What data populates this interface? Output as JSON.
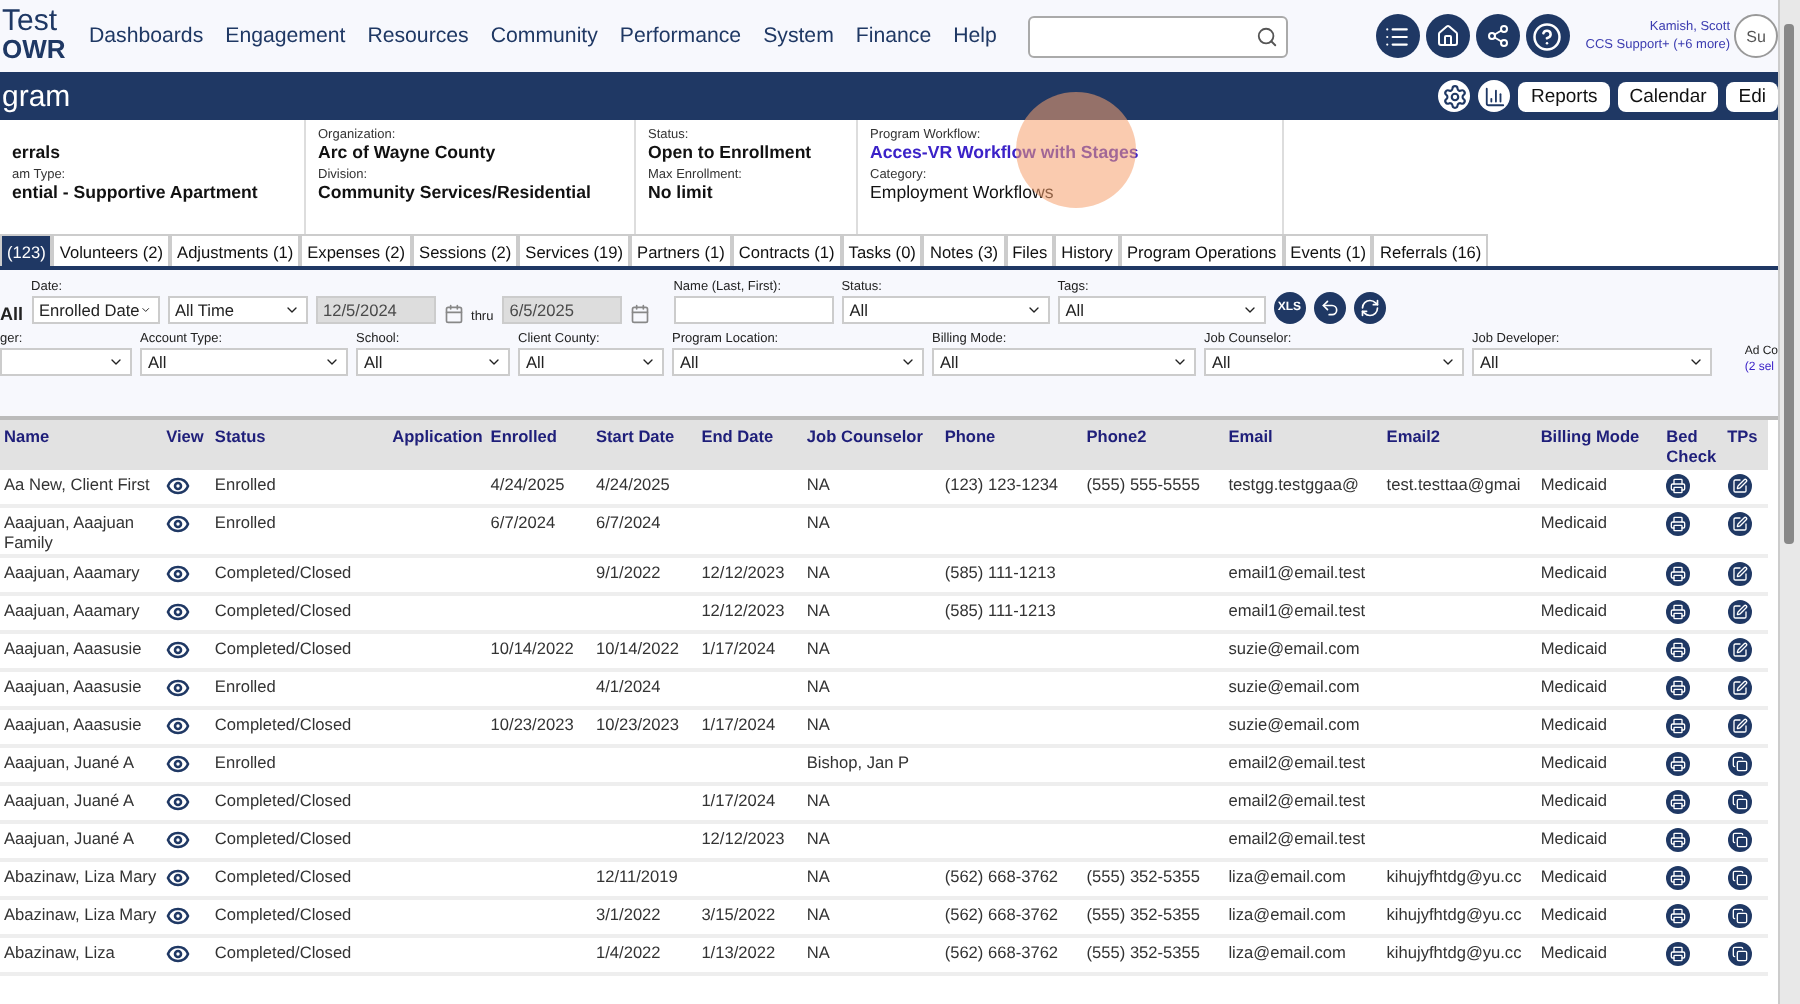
{
  "nav": {
    "logo_top": "Test",
    "logo_bottom": "OWR",
    "menu": [
      "Dashboards",
      "Engagement",
      "Resources",
      "Community",
      "Performance",
      "System",
      "Finance",
      "Help"
    ],
    "user_name": "Kamish, Scott",
    "user_role": "CCS Support+ (+6 more)",
    "avatar_text": "Su"
  },
  "title_bar": {
    "title": "gram",
    "buttons": [
      "Reports",
      "Calendar",
      "Edi"
    ]
  },
  "info": [
    {
      "kind": "text",
      "value": "errals",
      "label2": "am Type:",
      "value2": "ential - Supportive Apartment"
    },
    {
      "kind": "text",
      "label": "Organization:",
      "value": "Arc of Wayne County",
      "label2": "Division:",
      "value2": "Community Services/Residential"
    },
    {
      "kind": "text",
      "label": "Status:",
      "value": "Open to Enrollment",
      "label2": "Max Enrollment:",
      "value2": "No limit"
    },
    {
      "kind": "link",
      "label": "Program Workflow:",
      "value": "Acces-VR Workflow with Stages",
      "label2": "Category:",
      "value2": "Employment Workflows"
    }
  ],
  "tabs": [
    {
      "label": "(123)",
      "selected": true
    },
    {
      "label": "Volunteers (2)",
      "selected": false
    },
    {
      "label": "Adjustments (1)",
      "selected": false
    },
    {
      "label": "Expenses (2)",
      "selected": false
    },
    {
      "label": "Sessions (2)",
      "selected": false
    },
    {
      "label": "Services (19)",
      "selected": false
    },
    {
      "label": "Partners (1)",
      "selected": false
    },
    {
      "label": "Contracts (1)",
      "selected": false
    },
    {
      "label": "Tasks (0)",
      "selected": false
    },
    {
      "label": "Notes (3)",
      "selected": false
    },
    {
      "label": "Files",
      "selected": false
    },
    {
      "label": "History",
      "selected": false
    },
    {
      "label": "Program Operations",
      "selected": false
    },
    {
      "label": "Events (1)",
      "selected": false
    },
    {
      "label": "Referrals (16)",
      "selected": false
    }
  ],
  "filters_row1": {
    "cut_label": "All",
    "date_label": "Date:",
    "date_type": "Enrolled Date",
    "range": "All Time",
    "from": {
      "value": "12/5/2024",
      "disabled": true
    },
    "thru": "thru",
    "to": {
      "value": "6/5/2025",
      "disabled": true
    },
    "name_label": "Name (Last, First):",
    "status_label": "Status:",
    "status": "All",
    "tags_label": "Tags:",
    "tags": "All",
    "xls": "XLS"
  },
  "filters_row2": [
    {
      "label": "ger:"
    },
    {
      "label": "Account Type:",
      "value": "All"
    },
    {
      "label": "School:",
      "value": "All"
    },
    {
      "label": "Client County:",
      "value": "All"
    },
    {
      "label": "Program Location:",
      "value": "All"
    },
    {
      "label": "Billing Mode:",
      "value": "All"
    },
    {
      "label": "Job Counselor:",
      "value": "All"
    },
    {
      "label": "Job Developer:",
      "value": "All"
    }
  ],
  "cut_filter": {
    "label": "Ad Co",
    "note": "(2 sel"
  },
  "table": {
    "columns": [
      "Name",
      "View",
      "Status",
      "Application",
      "Enrolled",
      "Start Date",
      "End Date",
      "Job Counselor",
      "Phone",
      "Phone2",
      "Email",
      "Email2",
      "Billing Mode",
      "Bed Check",
      "TPs"
    ],
    "rows": [
      {
        "name": "Aa New, Client First",
        "status": "Enrolled",
        "enrolled": "4/24/2025",
        "start": "4/24/2025",
        "counselor": "NA",
        "phone": "(123) 123-1234",
        "phone2": "(555) 555-5555",
        "email": "testgg.testggaa@",
        "email2": "test.testtaa@gmai",
        "billing": "Medicaid",
        "tp": {
          "kind": "edit"
        }
      },
      {
        "name": "Aaajuan, Aaajuan Family",
        "status": "Enrolled",
        "enrolled": "6/7/2024",
        "start": "6/7/2024",
        "counselor": "NA",
        "billing": "Medicaid",
        "tp": {
          "kind": "edit"
        }
      },
      {
        "name": "Aaajuan, Aaamary",
        "status": "Completed/Closed",
        "start": "9/1/2022",
        "end": "12/12/2023",
        "counselor": "NA",
        "phone": "(585) 111-1213",
        "email": "email1@email.test",
        "billing": "Medicaid",
        "tp": {
          "kind": "edit"
        }
      },
      {
        "name": "Aaajuan, Aaamary",
        "status": "Completed/Closed",
        "end": "12/12/2023",
        "counselor": "NA",
        "phone": "(585) 111-1213",
        "email": "email1@email.test",
        "billing": "Medicaid",
        "tp": {
          "kind": "edit"
        }
      },
      {
        "name": "Aaajuan, Aaasusie",
        "status": "Completed/Closed",
        "enrolled": "10/14/2022",
        "start": "10/14/2022",
        "end": "1/17/2024",
        "counselor": "NA",
        "email": "suzie@email.com",
        "billing": "Medicaid",
        "tp": {
          "kind": "edit"
        }
      },
      {
        "name": "Aaajuan, Aaasusie",
        "status": "Enrolled",
        "start": "4/1/2024",
        "counselor": "NA",
        "email": "suzie@email.com",
        "billing": "Medicaid",
        "tp": {
          "kind": "edit"
        }
      },
      {
        "name": "Aaajuan, Aaasusie",
        "status": "Completed/Closed",
        "enrolled": "10/23/2023",
        "start": "10/23/2023",
        "end": "1/17/2024",
        "counselor": "NA",
        "email": "suzie@email.com",
        "billing": "Medicaid",
        "tp": {
          "kind": "edit"
        }
      },
      {
        "name": "Aaajuan, Juané A",
        "status": "Enrolled",
        "counselor": "Bishop, Jan P",
        "email": "email2@email.test",
        "billing": "Medicaid",
        "tp": {
          "kind": "copy"
        }
      },
      {
        "name": "Aaajuan, Juané A",
        "status": "Completed/Closed",
        "end": "1/17/2024",
        "counselor": "NA",
        "email": "email2@email.test",
        "billing": "Medicaid",
        "tp": {
          "kind": "copy"
        }
      },
      {
        "name": "Aaajuan, Juané A",
        "status": "Completed/Closed",
        "end": "12/12/2023",
        "counselor": "NA",
        "email": "email2@email.test",
        "billing": "Medicaid",
        "tp": {
          "kind": "copy"
        }
      },
      {
        "name": "Abazinaw, Liza Mary",
        "status": "Completed/Closed",
        "start": "12/11/2019",
        "counselor": "NA",
        "phone": "(562) 668-3762",
        "phone2": "(555) 352-5355",
        "email": "liza@email.com",
        "email2": "kihujyfhtdg@yu.cc",
        "billing": "Medicaid",
        "tp": {
          "kind": "copy"
        }
      },
      {
        "name": "Abazinaw, Liza Mary",
        "status": "Completed/Closed",
        "start": "3/1/2022",
        "end": "3/15/2022",
        "counselor": "NA",
        "phone": "(562) 668-3762",
        "phone2": "(555) 352-5355",
        "email": "liza@email.com",
        "email2": "kihujyfhtdg@yu.cc",
        "billing": "Medicaid",
        "tp": {
          "kind": "copy"
        }
      },
      {
        "name": "Abazinaw, Liza",
        "status": "Completed/Closed",
        "start": "1/4/2022",
        "end": "1/13/2022",
        "counselor": "NA",
        "phone": "(562) 668-3762",
        "phone2": "(555) 352-5355",
        "email": "liza@email.com",
        "email2": "kihujyfhtdg@yu.cc",
        "billing": "Medicaid",
        "tp": {
          "kind": "copy"
        }
      }
    ]
  }
}
